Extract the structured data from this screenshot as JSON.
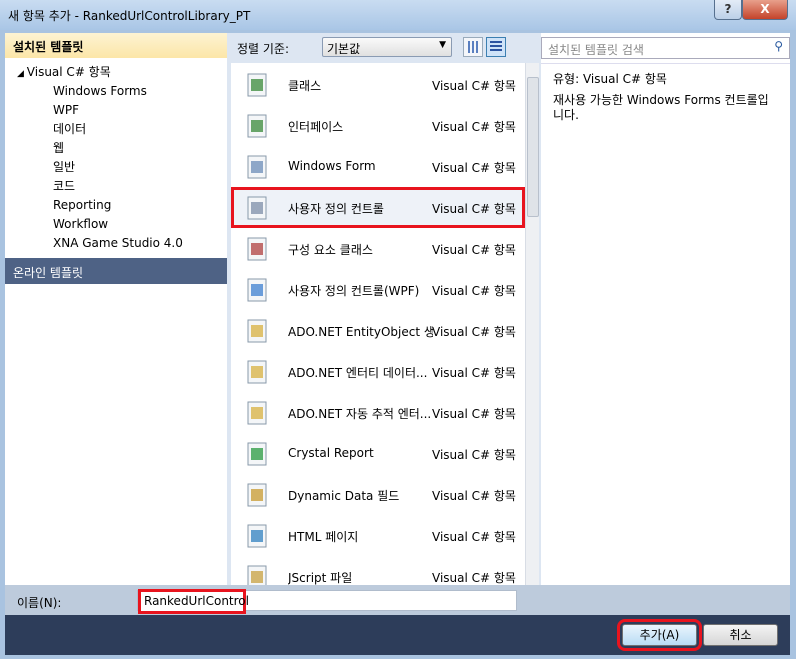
{
  "window": {
    "title": "새 항목 추가 - RankedUrlControlLibrary_PT",
    "help": "?",
    "close": "X"
  },
  "left": {
    "header": "설치된 템플릿",
    "tree_root": "Visual C# 항목",
    "tree_children": [
      "Windows Forms",
      "WPF",
      "데이터",
      "웹",
      "일반",
      "코드",
      "Reporting",
      "Workflow",
      "XNA Game Studio 4.0"
    ],
    "online": "온라인 템플릿"
  },
  "toolbar": {
    "sort_label": "정렬 기준:",
    "sort_value": "기본값"
  },
  "search": {
    "placeholder": "설치된 템플릿 검색"
  },
  "items": [
    {
      "name": "클래스",
      "cat": "Visual C# 항목",
      "icon": "class-icon"
    },
    {
      "name": "인터페이스",
      "cat": "Visual C# 항목",
      "icon": "interface-icon"
    },
    {
      "name": "Windows Form",
      "cat": "Visual C# 항목",
      "icon": "form-icon"
    },
    {
      "name": "사용자 정의 컨트롤",
      "cat": "Visual C# 항목",
      "icon": "user-control-icon"
    },
    {
      "name": "구성 요소 클래스",
      "cat": "Visual C# 항목",
      "icon": "component-icon"
    },
    {
      "name": "사용자 정의 컨트롤(WPF)",
      "cat": "Visual C# 항목",
      "icon": "wpf-control-icon"
    },
    {
      "name": "ADO.NET EntityObject 생...",
      "cat": "Visual C# 항목",
      "icon": "database-icon"
    },
    {
      "name": "ADO.NET 엔터티 데이터...",
      "cat": "Visual C# 항목",
      "icon": "database-icon"
    },
    {
      "name": "ADO.NET 자동 추적 엔터...",
      "cat": "Visual C# 항목",
      "icon": "database-icon"
    },
    {
      "name": "Crystal Report",
      "cat": "Visual C# 항목",
      "icon": "crystal-report-icon"
    },
    {
      "name": "Dynamic Data 필드",
      "cat": "Visual C# 항목",
      "icon": "dynamic-data-icon"
    },
    {
      "name": "HTML 페이지",
      "cat": "Visual C# 항목",
      "icon": "html-page-icon"
    },
    {
      "name": "JScript 파일",
      "cat": "Visual C# 항목",
      "icon": "jscript-icon"
    }
  ],
  "selected_index": 3,
  "info": {
    "type_label": "유형:",
    "type_value": "Visual C# 항목",
    "description": "재사용 가능한 Windows Forms 컨트롤입니다."
  },
  "name_field": {
    "label": "이름(N):",
    "value": "RankedUrlControl"
  },
  "buttons": {
    "add": "추가(A)",
    "cancel": "취소"
  },
  "colors": {
    "highlight": "#e8141e",
    "online_bar": "#4e6285",
    "footer": "#2d3d5a"
  }
}
